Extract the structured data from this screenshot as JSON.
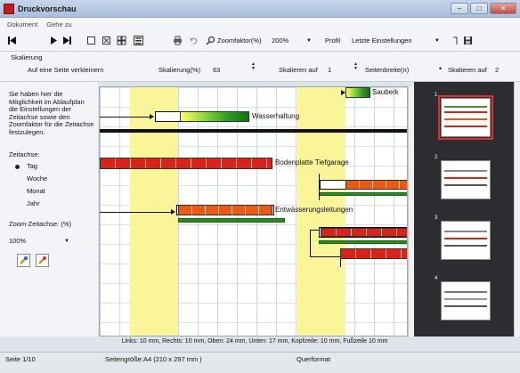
{
  "window": {
    "title": "Druckvorschau"
  },
  "menu": {
    "items": [
      "Dokument",
      "Gehe zu"
    ]
  },
  "toolbar": {
    "zoom_label": "Zoomfaktor(%)",
    "zoom_value": "200%",
    "profile_label": "Profil",
    "profile_value": "Letzte Einstellungen"
  },
  "scaling": {
    "section_title": "Skalierung",
    "fit_one_page": "Auf eine Seite verkleinern",
    "scale_label": "Skalierung(%)",
    "scale_value": "63",
    "scale_to_label": "Skalieren auf",
    "scale_to_value": "1",
    "page_width_label": "Seitenbreite(n)",
    "scale_to2_label": "Skalieren auf",
    "scale_to2_value": "2"
  },
  "left_panel": {
    "info": "Sie haben hier die Möglichkeit im Ablaufplan die Einstellungen der Zeitachse sowie den Zoomfaktor für die Zeitachse festzulegen.",
    "timeaxis_label": "Zeitachse:",
    "options": [
      "Tag",
      "Woche",
      "Monat",
      "Jahr"
    ],
    "selected_option": "Tag",
    "zoom_label": "Zoom-Zeitachse: (%)",
    "zoom_value": "100%"
  },
  "gantt": {
    "tasks": [
      "Sauberk",
      "Wasserhaltung",
      "Bodenplatte Tiefgarage",
      "Entwässerungsleitungen"
    ]
  },
  "thumbnails": {
    "numbers": [
      "1",
      "2",
      "3",
      "4"
    ],
    "selected": "1"
  },
  "footer": {
    "margins": "Links: 10 mm, Rechts: 10 mm, Oben: 24 mm, Unten: 17 mm, Kopfzeile: 10 mm, Fußzeile 10 mm",
    "page": "Seite 1/10",
    "page_size": "Seitengröße:A4 (210 x 297 mm )",
    "orientation": "Querformat"
  },
  "colors": {
    "titlebar": "#a9bedc",
    "accent_red": "#d8231a",
    "weekend": "#fbf59a",
    "green": "#2e9b1f",
    "thumb_panel": "#2b2d31"
  }
}
